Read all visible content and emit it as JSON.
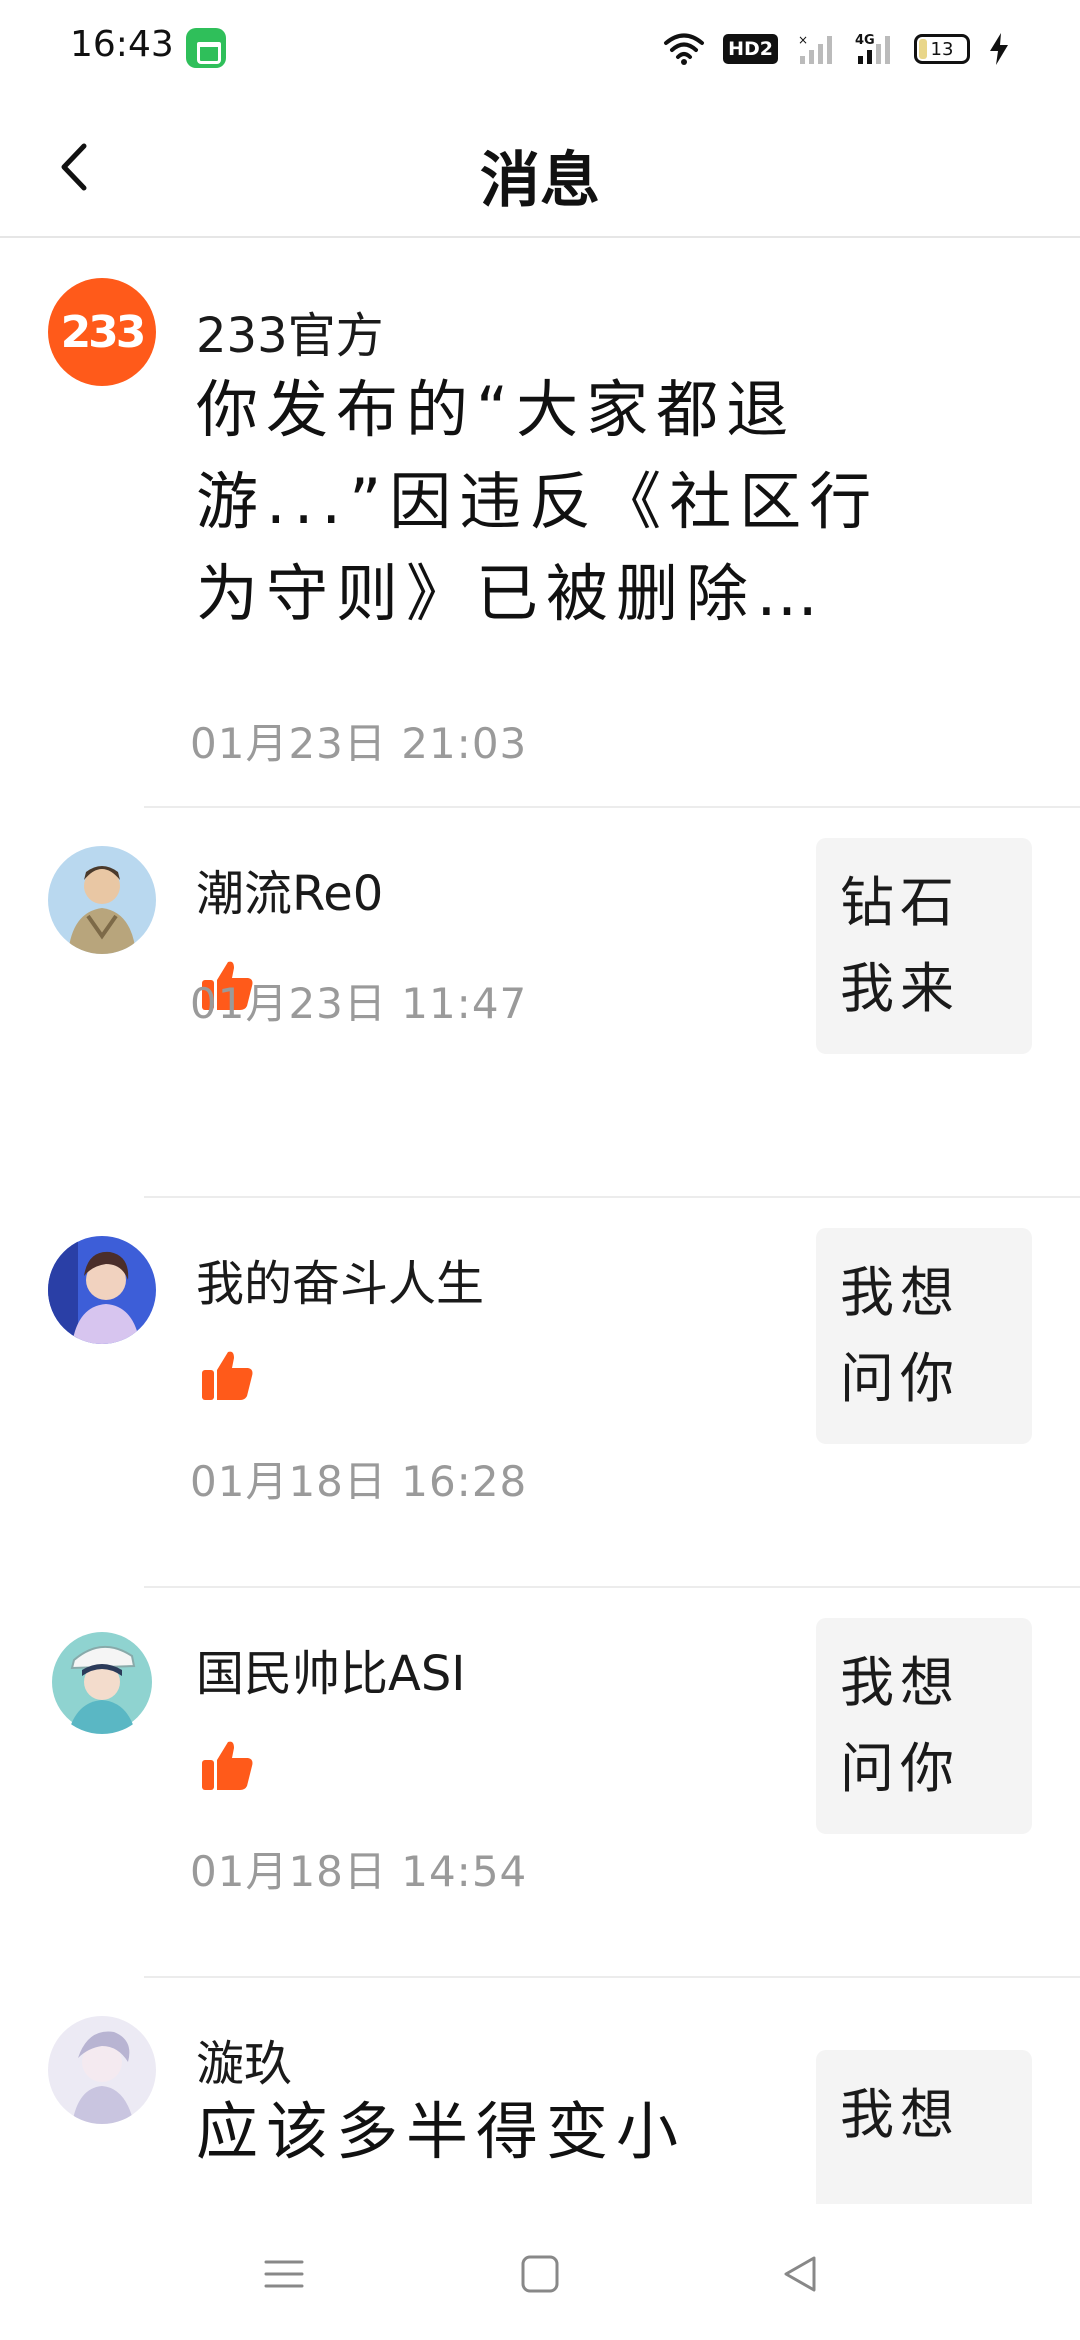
{
  "status_bar": {
    "time": "16:43",
    "network_badge": "HD2",
    "network_type": "4G",
    "battery_level": "13",
    "icons": [
      "app-store-icon",
      "wifi-icon",
      "signal-icon",
      "battery-icon",
      "charging-icon"
    ]
  },
  "header": {
    "title": "消息",
    "back_icon": "chevron-left-icon"
  },
  "messages": [
    {
      "sender": "233官方",
      "avatar_text": "233",
      "avatar_color": "#ff5a1a",
      "body": "你发布的“大家都退游...”因违反《社区行为守则》已被删除…",
      "time": "01月23日  21:03"
    },
    {
      "sender": "潮流Re0",
      "action_icon": "thumbs-up-icon",
      "time": "01月23日  11:47",
      "quote": "钻石我来"
    },
    {
      "sender": "我的奋斗人生",
      "action_icon": "thumbs-up-icon",
      "time": "01月18日  16:28",
      "quote": "我想问你"
    },
    {
      "sender": "国民帅比ASI",
      "action_icon": "thumbs-up-icon",
      "time": "01月18日  14:54",
      "quote": "我想问你"
    },
    {
      "sender": "漩玖",
      "body": "应该多半得变小",
      "quote": "我想"
    }
  ],
  "colors": {
    "accent": "#ff5a1a",
    "like": "#ff5a1a",
    "divider": "#ececec",
    "quote_bg": "#f4f4f4",
    "timestamp": "#9a9a9a"
  },
  "nav_bar": {
    "icons": [
      "menu-icon",
      "home-icon",
      "back-triangle-icon"
    ]
  }
}
